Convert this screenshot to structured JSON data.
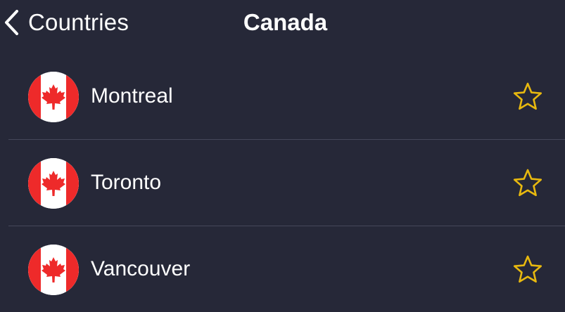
{
  "nav": {
    "back_label": "Countries",
    "title": "Canada"
  },
  "cities": [
    {
      "name": "Montreal",
      "flag_icon": "canada-flag-icon",
      "favorited": false
    },
    {
      "name": "Toronto",
      "flag_icon": "canada-flag-icon",
      "favorited": false
    },
    {
      "name": "Vancouver",
      "flag_icon": "canada-flag-icon",
      "favorited": false
    }
  ],
  "icons": {
    "back": "chevron-left-icon",
    "favorite": "star-outline-icon"
  },
  "colors": {
    "background": "#262838",
    "text": "#ffffff",
    "divider": "#45485a",
    "star": "#e8b90f",
    "flag_red": "#ee2a2a"
  }
}
